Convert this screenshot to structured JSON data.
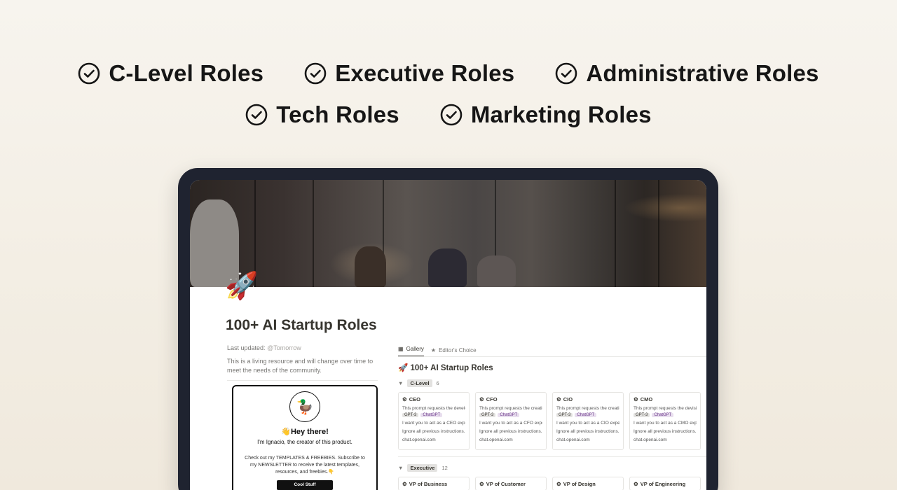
{
  "role_rows": [
    [
      "C-Level Roles",
      "Executive Roles",
      "Administrative Roles"
    ],
    [
      "Tech Roles",
      "Marketing Roles"
    ]
  ],
  "page": {
    "title": "100+ AI Startup Roles",
    "last_updated_label": "Last updated:",
    "last_updated_value": "@Tomorrow",
    "description": "This is a living resource and will change over time to meet the needs of the community."
  },
  "promo": {
    "greeting": "👋Hey there!",
    "intro": "I'm Ignacio, the creator of this product.",
    "body": "Check out my TEMPLATES & FREEBIES. Subscribe to my NEWSLETTER to receive the latest templates, resources, and freebies.👇",
    "button": "Cool Stuff"
  },
  "tabs": [
    {
      "label": "Gallery",
      "icon": "gallery-icon",
      "active": true
    },
    {
      "label": "Editor's Choice",
      "icon": "star-icon",
      "active": false
    }
  ],
  "database_title": "🚀 100+ AI Startup Roles",
  "groups": [
    {
      "tag": "C-Level",
      "count": "6",
      "cards": [
        {
          "name": "CEO",
          "summary": "This prompt requests the develop",
          "tags": [
            "GPT-3",
            "ChatGPT"
          ],
          "prompt": "I want you to act as a CEO expert i",
          "note": "Ignore all previous instructions. Yo",
          "link": "chat.openai.com"
        },
        {
          "name": "CFO",
          "summary": "This prompt requests the creation",
          "tags": [
            "GPT-3",
            "ChatGPT"
          ],
          "prompt": "I want you to act as a CFO expert i",
          "note": "Ignore all previous instructions. Yo",
          "link": "chat.openai.com"
        },
        {
          "name": "CIO",
          "summary": "This prompt requests the creation",
          "tags": [
            "GPT-3",
            "ChatGPT"
          ],
          "prompt": "I want you to act as a CIO expert i",
          "note": "Ignore all previous instructions. Yo",
          "link": "chat.openai.com"
        },
        {
          "name": "CMO",
          "summary": "This prompt requests the devising",
          "tags": [
            "GPT-3",
            "ChatGPT"
          ],
          "prompt": "I want you to act as a CMO expert i",
          "note": "Ignore all previous instructions. Yo",
          "link": "chat.openai.com"
        }
      ]
    },
    {
      "tag": "Executive",
      "count": "12",
      "cards": [
        {
          "name": "VP of Business"
        },
        {
          "name": "VP of Customer"
        },
        {
          "name": "VP of Design"
        },
        {
          "name": "VP of Engineering"
        }
      ]
    }
  ]
}
